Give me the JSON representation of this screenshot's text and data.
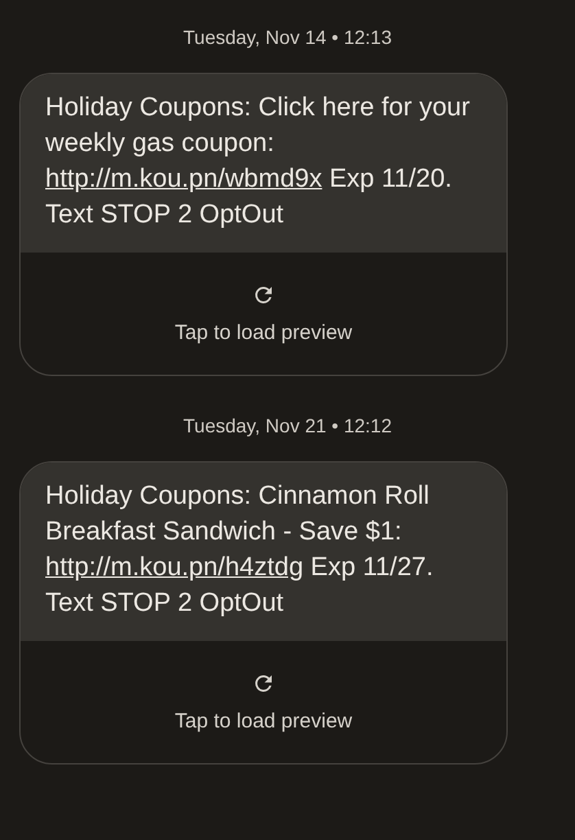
{
  "messages": [
    {
      "timestamp": "Tuesday, Nov 14 • 12:13",
      "parts": [
        {
          "kind": "text",
          "text": "Holiday Coupons: Click here for your weekly gas coupon: "
        },
        {
          "kind": "link",
          "text": "http://m.kou.pn/wbmd9x"
        },
        {
          "kind": "text",
          "text": " Exp 11/20. Text STOP 2 OptOut"
        }
      ],
      "preview": {
        "label": "Tap to load preview"
      }
    },
    {
      "timestamp": "Tuesday, Nov 21 • 12:12",
      "parts": [
        {
          "kind": "text",
          "text": "Holiday Coupons: Cinnamon Roll Breakfast Sandwich - Save $1: "
        },
        {
          "kind": "link",
          "text": "http://m.kou.pn/h4ztdg"
        },
        {
          "kind": "text",
          "text": " Exp 11/27. Text STOP 2 OptOut"
        }
      ],
      "preview": {
        "label": "Tap to load preview"
      }
    }
  ]
}
